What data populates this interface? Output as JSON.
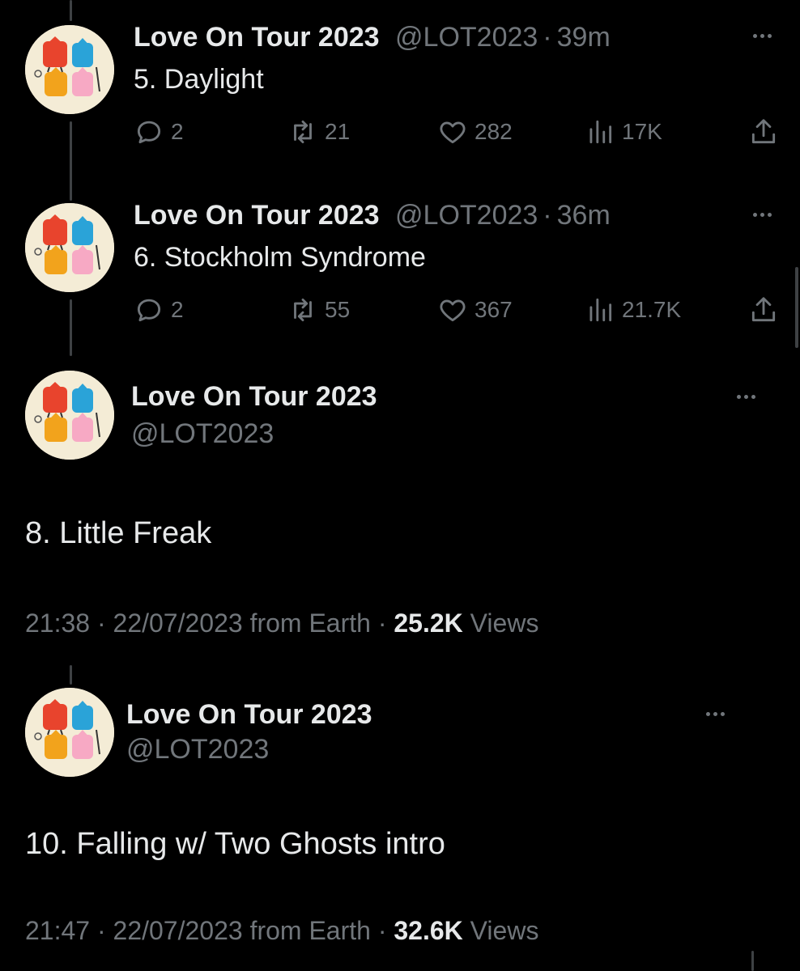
{
  "tweets": [
    {
      "name": "Love On Tour 2023",
      "handle": "@LOT2023",
      "separator": "·",
      "time": "39m",
      "text": "5. Daylight",
      "replies": "2",
      "retweets": "21",
      "likes": "282",
      "views": "17K"
    },
    {
      "name": "Love On Tour 2023",
      "handle": "@LOT2023",
      "separator": "·",
      "time": "36m",
      "text": "6. Stockholm Syndrome",
      "replies": "2",
      "retweets": "55",
      "likes": "367",
      "views": "21.7K"
    }
  ],
  "focused": [
    {
      "name": "Love On Tour 2023",
      "handle": "@LOT2023",
      "text": "8. Little Freak",
      "time": "21:38",
      "date": "22/07/2023",
      "source": "from Earth",
      "separator": "·",
      "views_count": "25.2K",
      "views_label": "Views"
    },
    {
      "name": "Love On Tour 2023",
      "handle": "@LOT2023",
      "text": "10. Falling w/ Two Ghosts intro",
      "time": "21:47",
      "date": "22/07/2023",
      "source": "from Earth",
      "separator": "·",
      "views_count": "32.6K",
      "views_label": "Views"
    }
  ],
  "icons": {
    "reply": "reply-icon",
    "retweet": "retweet-icon",
    "like": "heart-icon",
    "views": "bar-chart-icon",
    "share": "share-icon",
    "more": "more-icon"
  },
  "colors": {
    "background": "#000000",
    "text": "#e7e9ea",
    "muted": "#71767b",
    "avatar_bg": "#f4ecd6"
  }
}
